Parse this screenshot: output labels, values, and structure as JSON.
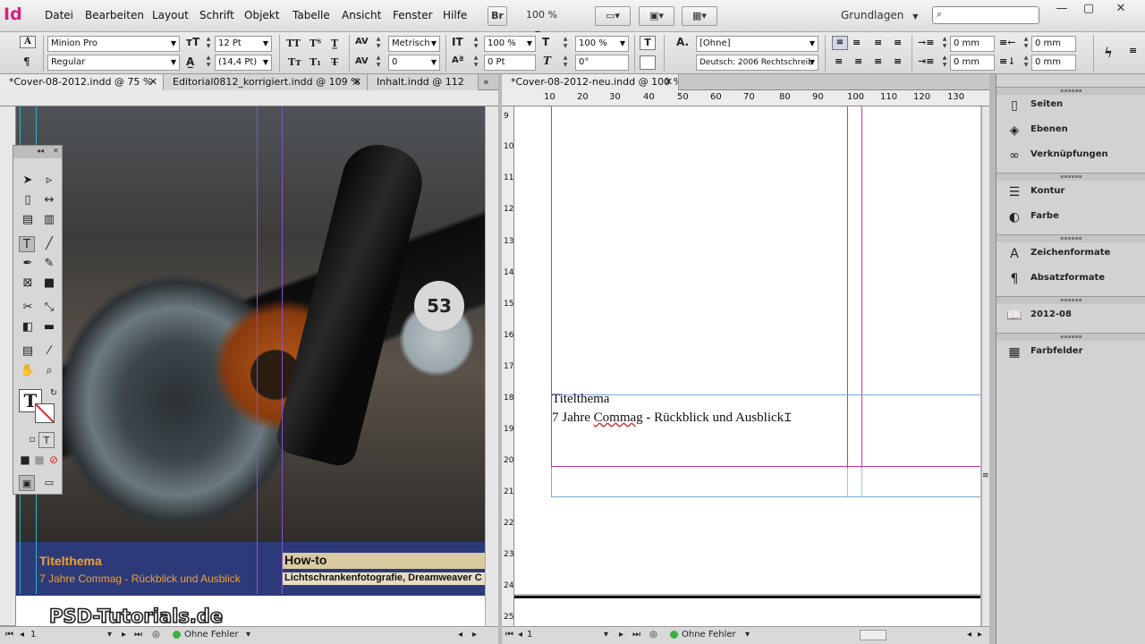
{
  "app": {
    "logo": "Id"
  },
  "menu": [
    "Datei",
    "Bearbeiten",
    "Layout",
    "Schrift",
    "Objekt",
    "Tabelle",
    "Ansicht",
    "Fenster",
    "Hilfe"
  ],
  "menubar": {
    "bridge": "Br",
    "zoom": "100 %",
    "workspace": "Grundlagen"
  },
  "control": {
    "font_family": "Minion Pro",
    "font_style": "Regular",
    "font_size": "12 Pt",
    "leading": "(14,4 Pt)",
    "kerning": "Metrisch",
    "tracking": "0",
    "vscale": "100 %",
    "hscale": "100 %",
    "baseline": "0 Pt",
    "skew": "0°",
    "char_style": "[Ohne]",
    "language": "Deutsch: 2006 Rechtschreib",
    "indent_left": "0 mm",
    "indent_first": "0 mm",
    "space_right": "0 mm",
    "space_after": "0 mm"
  },
  "tabs_left": [
    {
      "label": "*Cover-08-2012.indd @ 75 %"
    },
    {
      "label": "Editorial0812_korrigiert.indd @ 109 %"
    },
    {
      "label": "Inhalt.indd @ 112"
    }
  ],
  "tab_right": {
    "label": "*Cover-08-2012-neu.indd @ 100 %"
  },
  "cover": {
    "number": "53",
    "col1_title": "Titelthema",
    "col1_sub": "7 Jahre Commag - Rückblick und Ausblick",
    "col2_title": "How-to",
    "col2_sub": "Lichtschrankenfotografie, Dreamweaver C",
    "watermark": "PSD-Tutorials.de"
  },
  "ruler_h": [
    "10",
    "20",
    "30",
    "40",
    "50",
    "60",
    "70",
    "80",
    "90",
    "100",
    "110",
    "120",
    "130"
  ],
  "ruler_v": [
    "9",
    "10",
    "11",
    "12",
    "13",
    "14",
    "15",
    "16",
    "17",
    "18",
    "19",
    "20",
    "21",
    "22",
    "23",
    "24",
    "25"
  ],
  "text_frame": {
    "line1": "Titelthema",
    "line2_a": "7 Jahre ",
    "line2_err": "Commag",
    "line2_b": " - Rückblick und Ausblick"
  },
  "status_left": {
    "page": "1",
    "preflight": "Ohne Fehler"
  },
  "status_right": {
    "page": "1",
    "preflight": "Ohne Fehler"
  },
  "panels": [
    {
      "label": "Seiten",
      "icon": "pages-icon"
    },
    {
      "label": "Ebenen",
      "icon": "layers-icon"
    },
    {
      "label": "Verknüpfungen",
      "icon": "links-icon"
    },
    {
      "label": "Kontur",
      "icon": "stroke-icon"
    },
    {
      "label": "Farbe",
      "icon": "color-icon"
    },
    {
      "label": "Zeichenformate",
      "icon": "char-styles-icon"
    },
    {
      "label": "Absatzformate",
      "icon": "para-styles-icon"
    },
    {
      "label": "2012-08",
      "icon": "library-icon"
    },
    {
      "label": "Farbfelder",
      "icon": "swatches-icon"
    }
  ],
  "colors": {
    "cover_blue": "#2c3a7a",
    "cover_orange": "#f0a030",
    "cover_tan": "#d9cba0",
    "guide_magenta": "#c437a8"
  }
}
